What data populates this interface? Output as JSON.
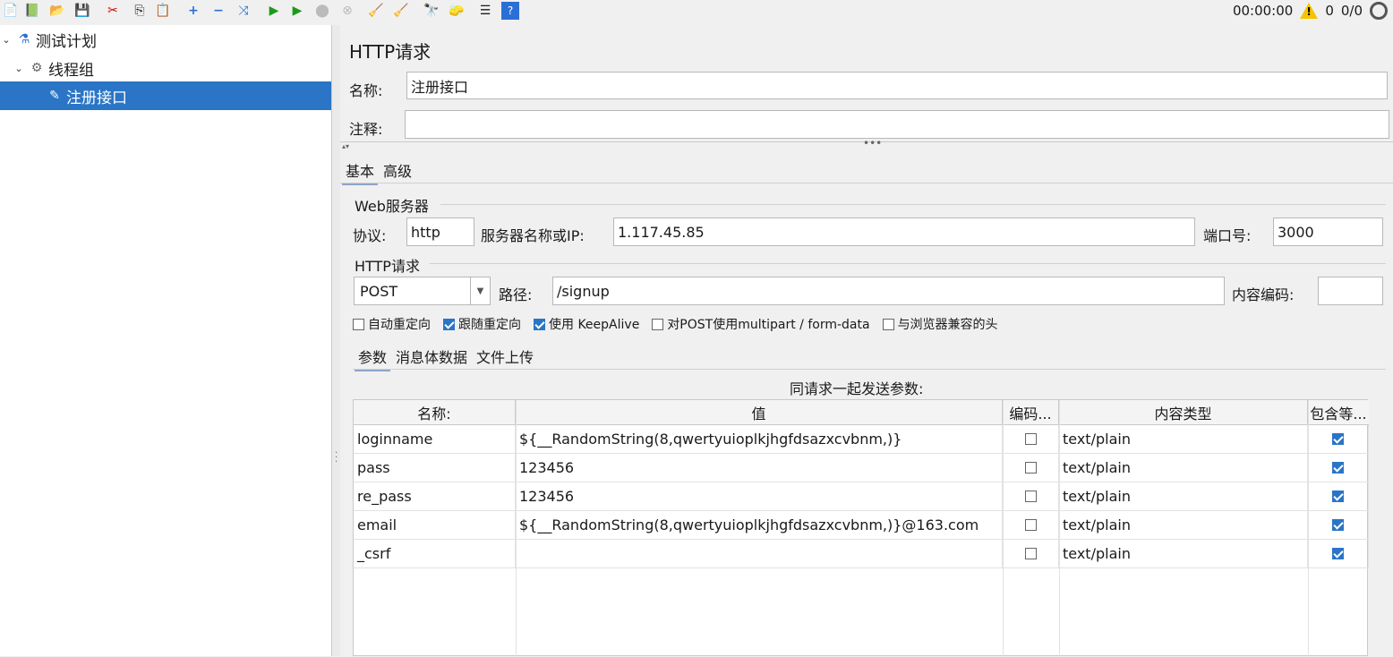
{
  "toolbar": {
    "icons": [
      "new-icon",
      "templates-icon",
      "open-icon",
      "save-icon",
      "cut-icon",
      "copy-icon",
      "paste-icon",
      "expand-icon",
      "collapse-icon",
      "toggle-icon",
      "start-icon",
      "start-no-pause-icon",
      "stop-icon",
      "shutdown-icon",
      "clear-icon",
      "clear-all-icon",
      "search-icon",
      "reset-search-icon",
      "function-helper-icon",
      "help-icon"
    ],
    "timer": "00:00:00",
    "warnings": "0",
    "threads": "0/0"
  },
  "tree": {
    "items": [
      {
        "label": "测试计划",
        "icon": "test-plan-icon"
      },
      {
        "label": "线程组",
        "icon": "thread-group-gear-icon"
      },
      {
        "label": "注册接口",
        "icon": "http-sampler-pen-icon"
      }
    ]
  },
  "panel": {
    "title": "HTTP请求",
    "name_label": "名称:",
    "name_value": "注册接口",
    "comment_label": "注释:",
    "comment_value": "",
    "tabs": [
      "基本",
      "高级"
    ],
    "web_server": {
      "section": "Web服务器",
      "protocol_label": "协议:",
      "protocol_value": "http",
      "server_label": "服务器名称或IP:",
      "server_value": "1.117.45.85",
      "port_label": "端口号:",
      "port_value": "3000"
    },
    "http_request": {
      "section": "HTTP请求",
      "method": "POST",
      "path_label": "路径:",
      "path_value": "/signup",
      "encoding_label": "内容编码:",
      "encoding_value": ""
    },
    "options": [
      {
        "label": "自动重定向",
        "checked": false
      },
      {
        "label": "跟随重定向",
        "checked": true
      },
      {
        "label": "使用 KeepAlive",
        "checked": true
      },
      {
        "label": "对POST使用multipart / form-data",
        "checked": false
      },
      {
        "label": "与浏览器兼容的头",
        "checked": false
      }
    ],
    "sub_tabs": [
      "参数",
      "消息体数据",
      "文件上传"
    ],
    "params_caption": "同请求一起发送参数:",
    "table": {
      "headers": [
        "名称:",
        "值",
        "编码...",
        "内容类型",
        "包含等..."
      ],
      "rows": [
        {
          "name": "loginname",
          "value": "${__RandomString(8,qwertyuioplkjhgfdsazxcvbnm,)}",
          "encode": false,
          "content_type": "text/plain",
          "include_equals": true
        },
        {
          "name": "pass",
          "value": "123456",
          "encode": false,
          "content_type": "text/plain",
          "include_equals": true
        },
        {
          "name": "re_pass",
          "value": "123456",
          "encode": false,
          "content_type": "text/plain",
          "include_equals": true
        },
        {
          "name": "email",
          "value": "${__RandomString(8,qwertyuioplkjhgfdsazxcvbnm,)}@163.com",
          "encode": false,
          "content_type": "text/plain",
          "include_equals": true
        },
        {
          "name": "_csrf",
          "value": "",
          "encode": false,
          "content_type": "text/plain",
          "include_equals": true
        }
      ]
    }
  }
}
